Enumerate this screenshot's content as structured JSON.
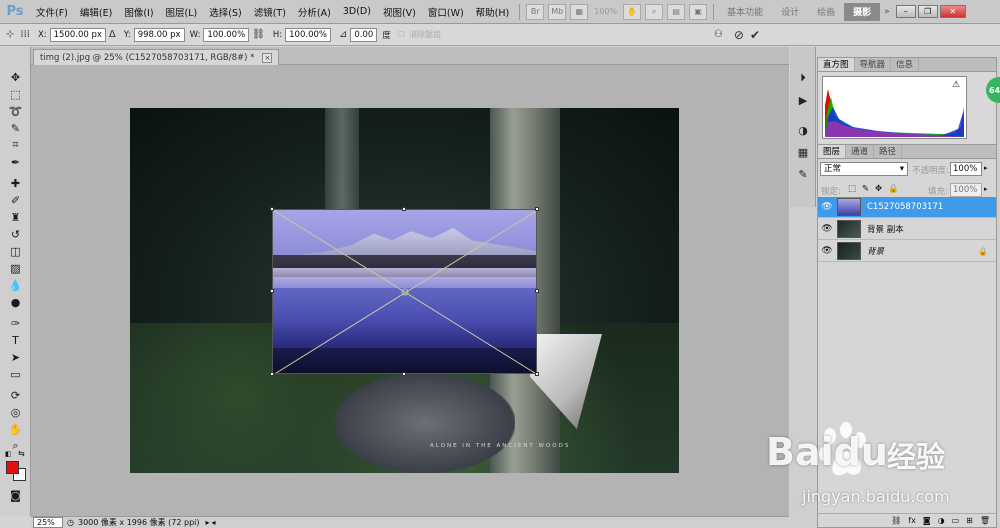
{
  "app": {
    "logo": "Ps"
  },
  "menu": [
    "文件(F)",
    "编辑(E)",
    "图像(I)",
    "图层(L)",
    "选择(S)",
    "滤镜(T)",
    "分析(A)",
    "3D(D)",
    "视图(V)",
    "窗口(W)",
    "帮助(H)"
  ],
  "menubar_zoom": "100%",
  "workspaces": [
    "基本功能",
    "设计",
    "绘画",
    "摄影"
  ],
  "workspace_active": "摄影",
  "options": {
    "x_label": "X:",
    "x_value": "1500.00 px",
    "y_label": "Y:",
    "y_value": "998.00 px",
    "w_label": "W:",
    "w_value": "100.00%",
    "h_label": "H:",
    "h_value": "100.00%",
    "angle_value": "0.00",
    "angle_unit": "度",
    "antialias_label": "消除锯齿"
  },
  "document": {
    "tab_title": "timg (2).jpg @ 25% (C1527058703171, RGB/8#) *",
    "close": "×",
    "caption": "ALONE IN THE ANCIENT WOODS"
  },
  "panels": {
    "hist_tabs": [
      "直方图",
      "导航器",
      "信息"
    ],
    "layers_tabs": [
      "图层",
      "通道",
      "路径"
    ],
    "blend_mode": "正常",
    "opacity_label": "不透明度:",
    "opacity_value": "100%",
    "lock_label": "锁定:",
    "fill_label": "填充:",
    "fill_value": "100%",
    "layers": [
      {
        "name": "C1527058703171",
        "selected": true
      },
      {
        "name": "背景 副本",
        "selected": false
      },
      {
        "name": "背景",
        "selected": false,
        "locked": true
      }
    ]
  },
  "status": {
    "zoom": "25%",
    "doc_info": "3000 像素 x 1996 像素 (72 ppi)"
  },
  "watermark": {
    "logo": "Baidu",
    "brand": "经验",
    "url": "jingyan.baidu.com"
  },
  "badge": "64"
}
